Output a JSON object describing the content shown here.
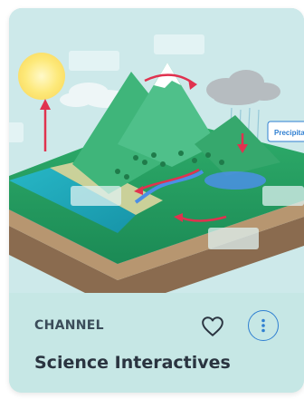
{
  "card": {
    "category": "CHANNEL",
    "title": "Science Interactives",
    "image_label": "Precipitation"
  },
  "icons": {
    "favorite": "heart-outline-icon",
    "more": "vertical-dots-icon"
  },
  "colors": {
    "accent": "#2f7fd1",
    "footer_bg": "#c6e7e5",
    "arrow": "#e0324f"
  }
}
